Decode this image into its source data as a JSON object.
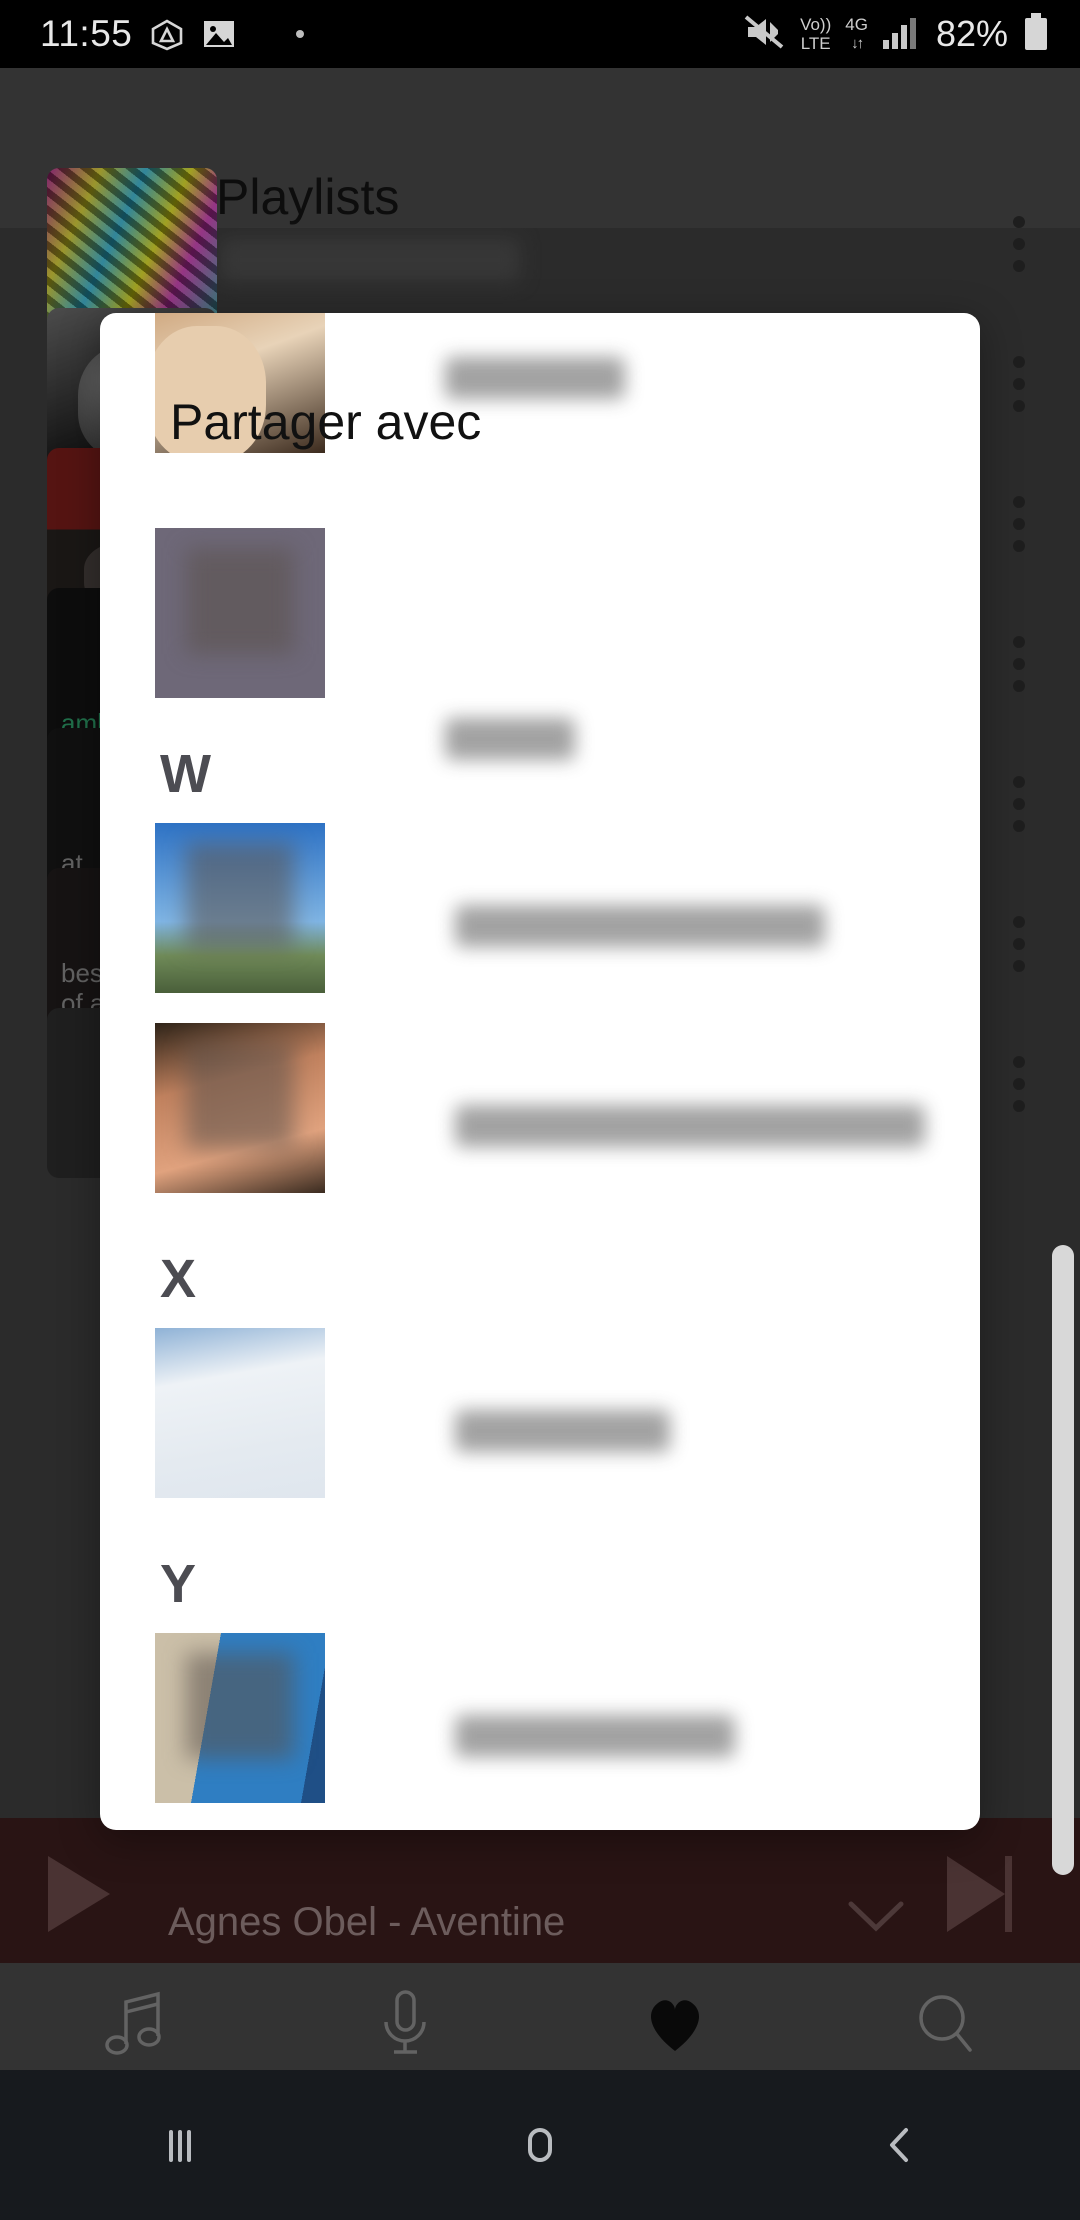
{
  "status_bar": {
    "clock": "11:55",
    "icons_left": [
      "drive-triangle-icon",
      "photo-icon",
      "dot-icon"
    ],
    "mute_icon": "volume-muted-icon",
    "volte_line1": "Vo))",
    "volte_line2": "LTE",
    "network_label": "4G",
    "network_arrows": "↓↑",
    "signal_icon": "signal-bars-icon",
    "battery_percent": "82%",
    "battery_icon": "battery-icon"
  },
  "app_bar": {
    "back_icon": "back-arrow-icon",
    "title": "Playlists"
  },
  "background_playlists": [
    {
      "art": "art-graffiti",
      "label": ""
    },
    {
      "art": "art-bw",
      "label": ""
    },
    {
      "art": "art-red",
      "label": ""
    },
    {
      "art": "art-dark",
      "label": "amb",
      "label_class": "green"
    },
    {
      "art": "art-dark2",
      "label": "at"
    },
    {
      "art": "art-best",
      "label": "best\nof all"
    },
    {
      "art": "art-plain",
      "label": ""
    }
  ],
  "overflow_menu_icon": "more-vertical-icon",
  "scrollbar": {
    "name": "page-scrollbar"
  },
  "share_dialog": {
    "title": "Partager avec",
    "items": [
      {
        "type": "contact",
        "avatar": "av-party",
        "avatar_name": "contact-avatar-party",
        "name_redacted": true
      },
      {
        "type": "contact",
        "avatar": "av-spider",
        "avatar_name": "contact-avatar-spiderman",
        "name_redacted": true
      },
      {
        "type": "section",
        "letter": "W"
      },
      {
        "type": "contact",
        "avatar": "av-pink",
        "avatar_name": "contact-avatar-outdoor",
        "name_redacted": true
      },
      {
        "type": "contact",
        "avatar": "av-face",
        "avatar_name": "contact-avatar-portrait",
        "name_redacted": true
      },
      {
        "type": "section",
        "letter": "X"
      },
      {
        "type": "contact",
        "avatar": "av-snow",
        "avatar_name": "contact-avatar-snow",
        "name_redacted": true
      },
      {
        "type": "section",
        "letter": "Y"
      },
      {
        "type": "contact",
        "avatar": "av-boat",
        "avatar_name": "contact-avatar-sailboat",
        "name_redacted": true
      }
    ]
  },
  "mini_player": {
    "play_icon": "play-icon",
    "track": "Agnes Obel - Aventine",
    "collapse_icon": "chevron-down-icon",
    "next_icon": "skip-next-icon"
  },
  "bottom_tabs": [
    {
      "label": "Musique",
      "icon": "music-note-icon",
      "active": false
    },
    {
      "label": "Podcasts",
      "icon": "microphone-icon",
      "active": false
    },
    {
      "label": "Favoris",
      "icon": "heart-icon",
      "active": true
    },
    {
      "label": "Recherche",
      "icon": "search-icon",
      "active": false
    }
  ],
  "android_nav": {
    "recents": "recents-icon",
    "home": "home-icon",
    "back": "back-icon"
  },
  "colors": {
    "dialog_bg": "#ffffff",
    "app_bar": "#4a4a4a",
    "player_bar": "#3c1e1e",
    "tab_bar": "#4a4a4a",
    "nav_bar": "#171a1e",
    "status_bar": "#000000"
  }
}
